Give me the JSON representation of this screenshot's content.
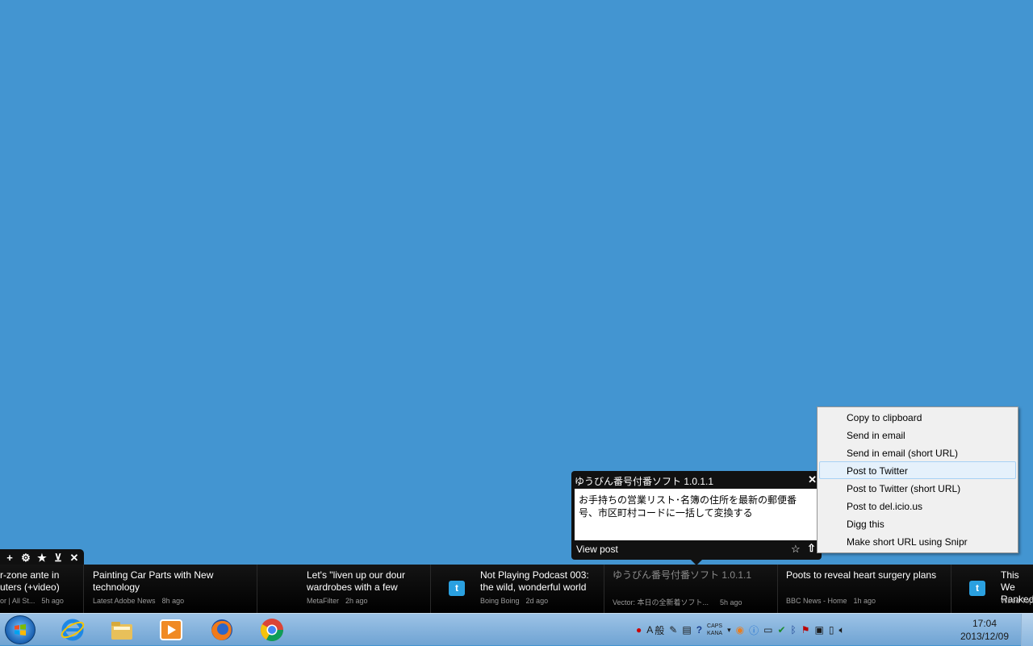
{
  "ticker_tools": {
    "add": "+",
    "settings": "⚙",
    "favorites": "★",
    "minimize": "⊻",
    "close": "✕"
  },
  "ticker": [
    {
      "title": "r-zone ante in\nuters (+video)",
      "source": "or | All St...",
      "age": "5h ago",
      "has_twitter": false
    },
    {
      "title": "Painting Car Parts with New technology",
      "source": "Latest Adobe News",
      "age": "8h ago",
      "has_twitter": false
    },
    {
      "title": "Let's \"liven up our dour wardrobes with a few",
      "source": "MetaFilter",
      "age": "2h ago",
      "has_twitter": false
    },
    {
      "title": "Not Playing Podcast 003: the wild, wonderful world",
      "source": "Boing Boing",
      "age": "2d ago",
      "has_twitter": true
    },
    {
      "title": "ゆうびん番号付番ソフト 1.0.1.1",
      "source": "Vector: 本日の全新着ソフト...",
      "age": "5h ago",
      "has_twitter": false
    },
    {
      "title": "Poots to reveal heart surgery plans",
      "source": "BBC News - Home",
      "age": "1h ago",
      "has_twitter": false
    },
    {
      "title": "This We\nRanked",
      "source": "Wired Top",
      "age": "",
      "has_twitter": true
    }
  ],
  "popup": {
    "title": "ゆうびん番号付番ソフト 1.0.1.1",
    "close": "✕",
    "body": "お手持ちの営業リスト･名簿の住所を最新の郵便番号、市区町村コードに一括して変換する",
    "view_post": "View post",
    "star": "☆",
    "share": "⇧"
  },
  "menu": {
    "items": [
      "Copy to clipboard",
      "Send in email",
      "Send in email (short URL)",
      "Post to Twitter",
      "Post to Twitter (short URL)",
      "Post to del.icio.us",
      "Digg this",
      "Make short URL using Snipr"
    ],
    "hover_index": 3
  },
  "taskbar": {
    "apps": [
      "internet-explorer",
      "file-explorer",
      "media-player",
      "firefox",
      "chrome"
    ],
    "tray": {
      "ime_a": "A",
      "ime_kanji": "般",
      "caps": "CAPS",
      "kana": "KANA"
    },
    "clock": {
      "time": "17:04",
      "date": "2013/12/09"
    }
  },
  "colors": {
    "desktop": "#4395d1",
    "ticker": "#000000",
    "menu_hover": "#e5f1fb"
  }
}
